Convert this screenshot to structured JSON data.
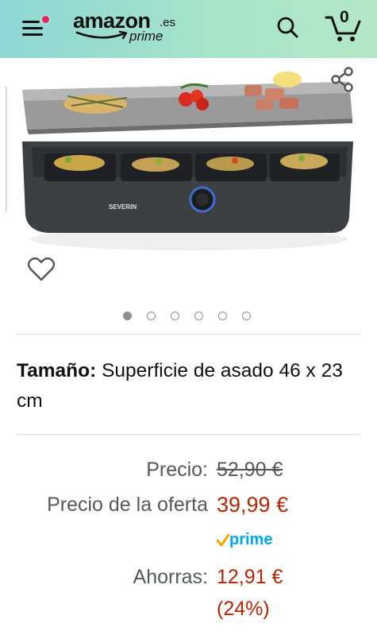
{
  "header": {
    "logo_text": "amazon",
    "logo_tld": ".es",
    "logo_prime": "prime",
    "cart_count": "0",
    "icons": [
      "menu-icon",
      "search-icon",
      "cart-icon"
    ]
  },
  "product": {
    "image_icons": [
      "share-icon",
      "heart-icon"
    ],
    "carousel": {
      "total": 6,
      "active": 0
    },
    "brand_on_device": "SEVERIN"
  },
  "size": {
    "label": "Tamaño:",
    "value": "Superficie de asado 46 x 23 cm"
  },
  "pricing": {
    "list_label": "Precio:",
    "list_price": "52,90 €",
    "deal_label": "Precio de la oferta",
    "deal_price": "39,99 €",
    "prime_label": "prime",
    "savings_label": "Ahorras:",
    "savings_amount": "12,91 €",
    "savings_percent": "(24%)"
  },
  "colors": {
    "header_gradient_start": "#8ed7d4",
    "header_gradient_end": "#b3e8c7",
    "price_red": "#b12704",
    "label_gray": "#565959",
    "prime_blue": "#00a8e1",
    "prime_check": "#f7a600",
    "notification_dot": "#e3266c"
  }
}
